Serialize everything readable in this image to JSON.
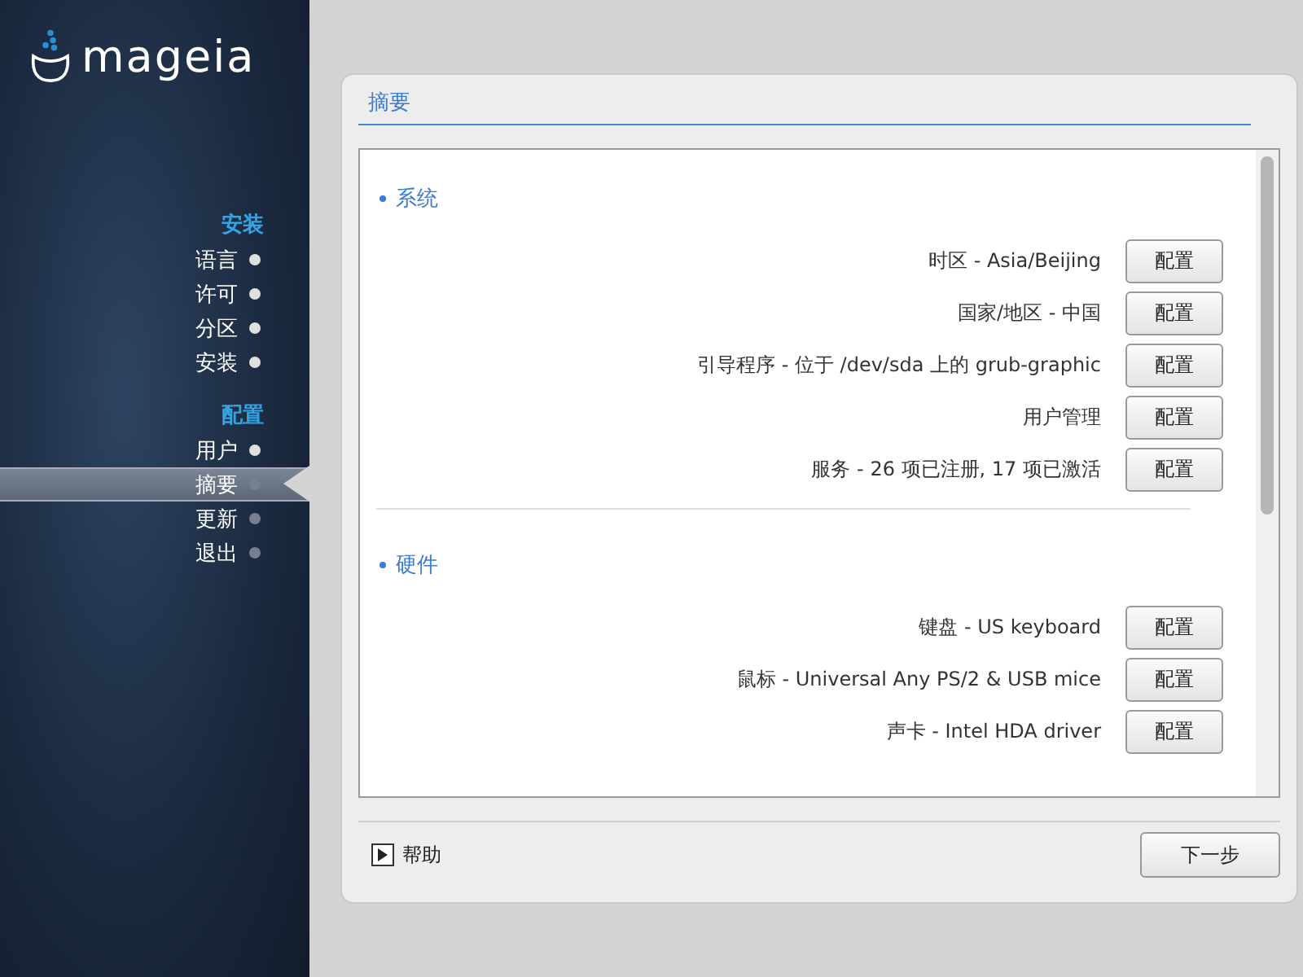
{
  "logo": {
    "text": "mageia"
  },
  "steps": [
    {
      "title": "安装",
      "items": [
        {
          "label": "语言",
          "done": true,
          "selected": false
        },
        {
          "label": "许可",
          "done": true,
          "selected": false
        },
        {
          "label": "分区",
          "done": true,
          "selected": false
        },
        {
          "label": "安装",
          "done": true,
          "selected": false
        }
      ]
    },
    {
      "title": "配置",
      "items": [
        {
          "label": "用户",
          "done": true,
          "selected": false
        },
        {
          "label": "摘要",
          "done": false,
          "selected": true
        },
        {
          "label": "更新",
          "done": false,
          "selected": false
        },
        {
          "label": "退出",
          "done": false,
          "selected": false
        }
      ]
    }
  ],
  "panel": {
    "title": "摘要"
  },
  "sections": [
    {
      "title": "系统",
      "rows": [
        {
          "label": "时区 - Asia/Beijing",
          "button": "配置"
        },
        {
          "label": "国家/地区 - 中国",
          "button": "配置"
        },
        {
          "label": "引导程序 - 位于 /dev/sda 上的 grub-graphic",
          "button": "配置"
        },
        {
          "label": "用户管理",
          "button": "配置"
        },
        {
          "label": "服务 - 26 项已注册, 17 项已激活",
          "button": "配置"
        }
      ]
    },
    {
      "title": "硬件",
      "rows": [
        {
          "label": "键盘 - US keyboard",
          "button": "配置"
        },
        {
          "label": "鼠标 - Universal Any PS/2 & USB mice",
          "button": "配置"
        },
        {
          "label": "声卡 - Intel HDA driver",
          "button": "配置"
        }
      ]
    }
  ],
  "footer": {
    "help": "帮助",
    "next": "下一步"
  }
}
